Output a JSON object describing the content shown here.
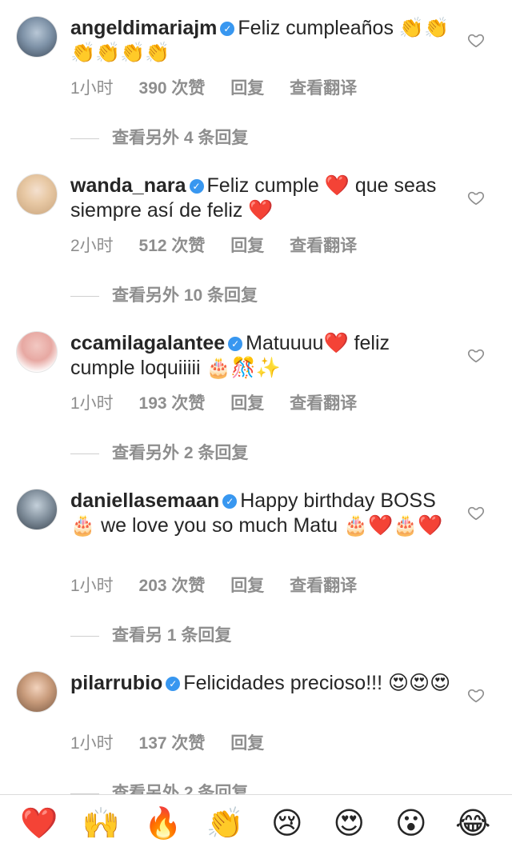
{
  "comments": [
    {
      "username": "angeldimariajm",
      "text": "Feliz cumpleaños 👏👏👏👏👏👏",
      "time": "1小时",
      "likes": "390 次赞",
      "reply": "回复",
      "translate": "查看翻译",
      "view_replies": "查看另外 4 条回复"
    },
    {
      "username": "wanda_nara",
      "text": "Feliz cumple ❤️ que seas siempre así de feliz ❤️",
      "time": "2小时",
      "likes": "512 次赞",
      "reply": "回复",
      "translate": "查看翻译",
      "view_replies": "查看另外 10 条回复"
    },
    {
      "username": "ccamilagalantee",
      "text": "Matuuuu❤️ feliz cumple loquiiiii 🎂🎊✨",
      "time": "1小时",
      "likes": "193 次赞",
      "reply": "回复",
      "translate": "查看翻译",
      "view_replies": "查看另外 2 条回复"
    },
    {
      "username": "daniellasemaan",
      "text": "Happy birthday BOSS🎂 we love you so much Matu 🎂❤️🎂❤️",
      "time": "1小时",
      "likes": "203 次赞",
      "reply": "回复",
      "translate": "查看翻译",
      "view_replies": "查看另 1 条回复"
    },
    {
      "username": "pilarrubio",
      "text": "Felicidades precioso!!! 😍😍😍",
      "time": "1小时",
      "likes": "137 次赞",
      "reply": "回复",
      "translate": "",
      "view_replies": "查看另外 2 条回复"
    }
  ],
  "emoji_bar": [
    "❤️",
    "🙌",
    "🔥",
    "👏",
    "😢",
    "😍",
    "😮",
    "😂"
  ],
  "colors": {
    "meta": "#8e8e8e",
    "verified": "#3897f0",
    "text": "#262626"
  },
  "icons": {
    "verified": "verified-badge-icon",
    "like": "heart-outline-icon"
  }
}
